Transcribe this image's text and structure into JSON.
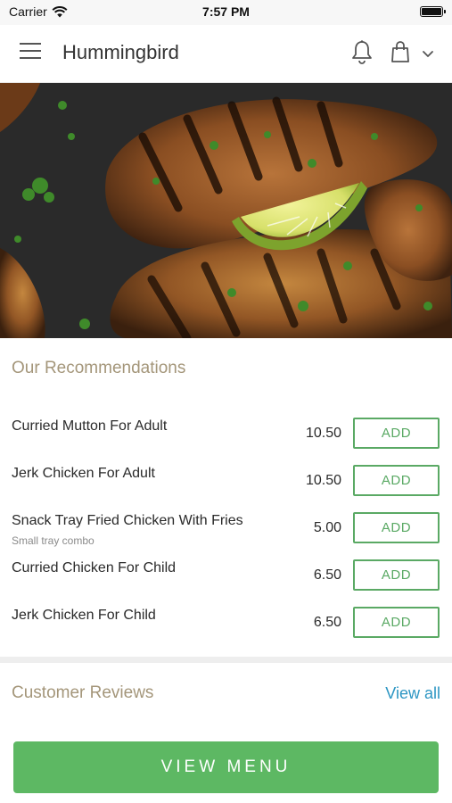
{
  "status_bar": {
    "carrier": "Carrier",
    "time": "7:57 PM"
  },
  "header": {
    "title": "Hummingbird"
  },
  "recommendations": {
    "title": "Our Recommendations",
    "items": [
      {
        "name": "Curried Mutton For Adult",
        "subtitle": "",
        "price": "10.50",
        "button": "ADD"
      },
      {
        "name": "Jerk Chicken For Adult",
        "subtitle": "",
        "price": "10.50",
        "button": "ADD"
      },
      {
        "name": "Snack Tray Fried Chicken With Fries",
        "subtitle": "Small tray combo",
        "price": "5.00",
        "button": "ADD"
      },
      {
        "name": "Curried Chicken For Child",
        "subtitle": "",
        "price": "6.50",
        "button": "ADD"
      },
      {
        "name": "Jerk Chicken For Child",
        "subtitle": "",
        "price": "6.50",
        "button": "ADD"
      }
    ]
  },
  "reviews": {
    "title": "Customer Reviews",
    "view_all": "View all"
  },
  "footer": {
    "view_menu": "VIEW MENU"
  },
  "colors": {
    "accent_green": "#5db863",
    "section_title": "#a4967a",
    "link_blue": "#2d96c3"
  }
}
